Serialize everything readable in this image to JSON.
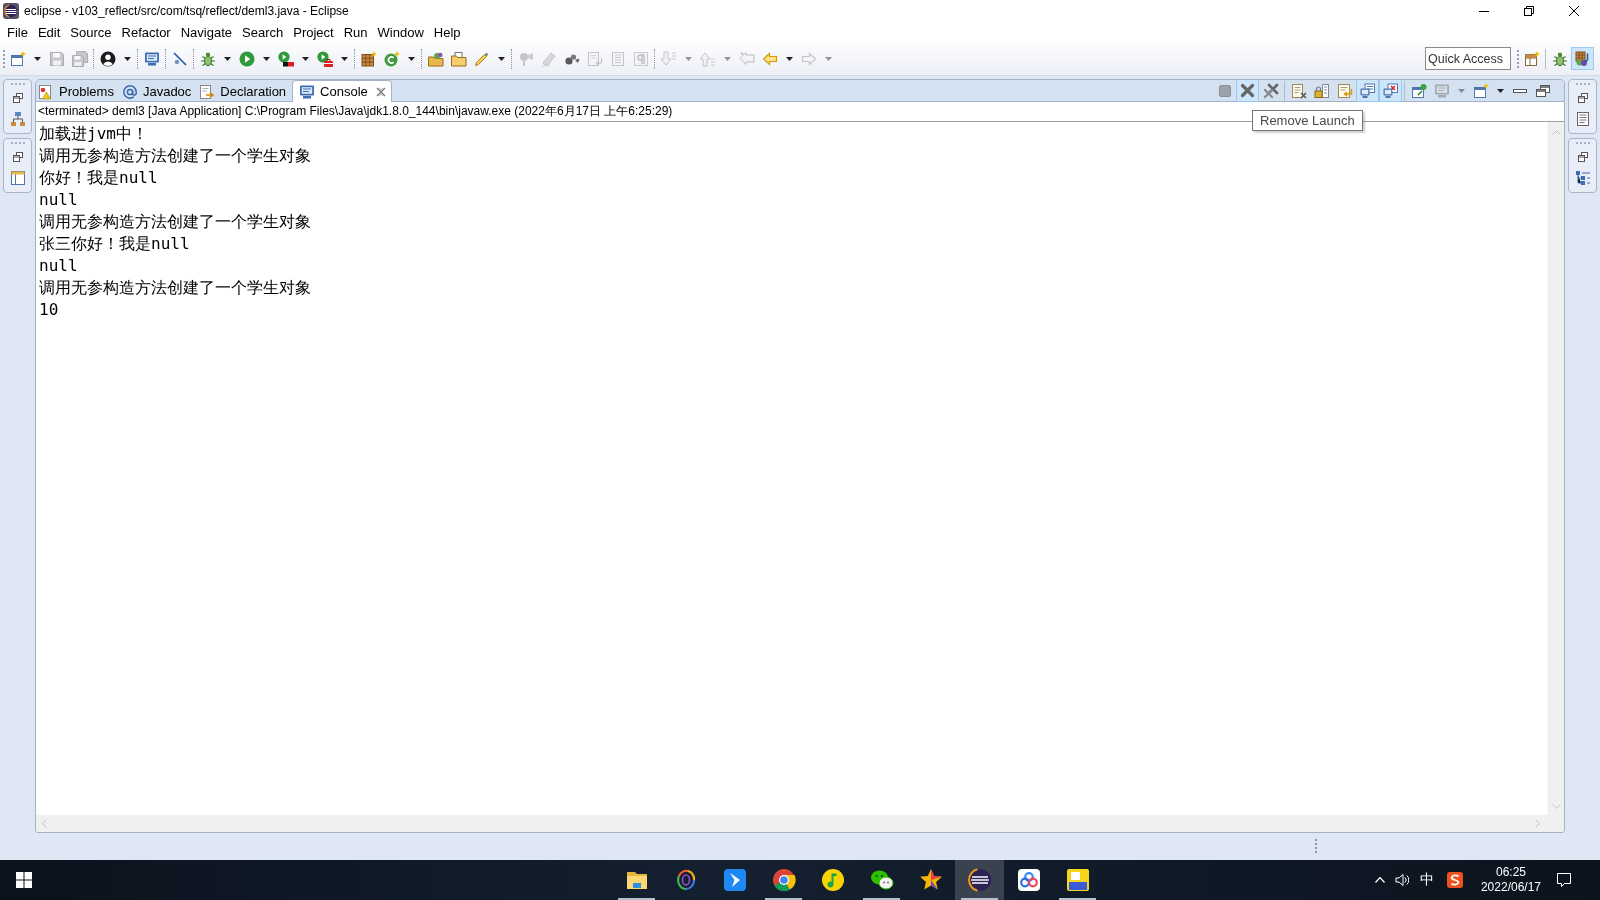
{
  "window": {
    "title": "eclipse - v103_reflect/src/com/tsq/reflect/deml3.java - Eclipse"
  },
  "menu": [
    "File",
    "Edit",
    "Source",
    "Refactor",
    "Navigate",
    "Search",
    "Project",
    "Run",
    "Window",
    "Help"
  ],
  "toolbar": {
    "items": [
      {
        "kind": "new",
        "disabled": false,
        "dropdown": true
      },
      {
        "kind": "save",
        "disabled": true,
        "dropdown": false
      },
      {
        "kind": "save_all",
        "disabled": true,
        "dropdown": false
      },
      {
        "kind": "separator"
      },
      {
        "kind": "person",
        "disabled": false,
        "dropdown": true
      },
      {
        "kind": "separator"
      },
      {
        "kind": "monitor",
        "disabled": false,
        "dropdown": false
      },
      {
        "kind": "separator"
      },
      {
        "kind": "skip",
        "disabled": false,
        "dropdown": false
      },
      {
        "kind": "separator"
      },
      {
        "kind": "debug",
        "disabled": false,
        "dropdown": true
      },
      {
        "kind": "run",
        "disabled": false,
        "dropdown": true
      },
      {
        "kind": "coverage",
        "disabled": false,
        "dropdown": true
      },
      {
        "kind": "external",
        "disabled": false,
        "dropdown": true
      },
      {
        "kind": "separator"
      },
      {
        "kind": "package",
        "disabled": false,
        "dropdown": false
      },
      {
        "kind": "class",
        "disabled": false,
        "dropdown": true
      },
      {
        "kind": "separator"
      },
      {
        "kind": "open_type",
        "disabled": false,
        "dropdown": false
      },
      {
        "kind": "open_task",
        "disabled": false,
        "dropdown": false
      },
      {
        "kind": "search",
        "disabled": false,
        "dropdown": true
      },
      {
        "kind": "separator"
      },
      {
        "kind": "pin",
        "disabled": true,
        "dropdown": false
      },
      {
        "kind": "eraser",
        "disabled": true,
        "dropdown": false
      },
      {
        "kind": "occurrences",
        "disabled": false,
        "dropdown": false
      },
      {
        "kind": "doc_arrow",
        "disabled": true,
        "dropdown": false
      },
      {
        "kind": "doc_lines",
        "disabled": true,
        "dropdown": false
      },
      {
        "kind": "pilcrow",
        "disabled": true,
        "dropdown": false
      },
      {
        "kind": "separator"
      },
      {
        "kind": "next",
        "disabled": true,
        "dropdown": true
      },
      {
        "kind": "prev",
        "disabled": true,
        "dropdown": true
      },
      {
        "kind": "last_edit",
        "disabled": true,
        "dropdown": false
      },
      {
        "kind": "back",
        "disabled": false,
        "dropdown": true
      },
      {
        "kind": "forward",
        "disabled": true,
        "dropdown": true
      }
    ],
    "quick_access": {
      "placeholder": "Quick Access"
    },
    "perspectives": [
      {
        "kind": "debug",
        "selected": false
      },
      {
        "kind": "java",
        "selected": true
      }
    ]
  },
  "view": {
    "tabs": [
      {
        "label": "Problems",
        "kind": "problems",
        "selected": false
      },
      {
        "label": "Javadoc",
        "kind": "javadoc",
        "selected": false
      },
      {
        "label": "Declaration",
        "kind": "declaration",
        "selected": false
      },
      {
        "label": "Console",
        "kind": "console",
        "selected": true
      }
    ],
    "toolbar": [
      {
        "kind": "terminate",
        "disabled": true,
        "highlighted": false,
        "dropdown": false
      },
      {
        "kind": "remove",
        "disabled": false,
        "highlighted": true,
        "dropdown": false
      },
      {
        "kind": "remove_all",
        "disabled": false,
        "highlighted": false,
        "dropdown": false
      },
      {
        "kind": "separator"
      },
      {
        "kind": "clear",
        "disabled": false,
        "highlighted": false,
        "dropdown": false
      },
      {
        "kind": "scroll_lock",
        "disabled": false,
        "highlighted": false,
        "dropdown": false
      },
      {
        "kind": "word_wrap",
        "disabled": false,
        "highlighted": false,
        "dropdown": false
      },
      {
        "kind": "stdout",
        "disabled": false,
        "highlighted": true,
        "dropdown": false
      },
      {
        "kind": "stderr",
        "disabled": false,
        "highlighted": true,
        "dropdown": false
      },
      {
        "kind": "separator"
      },
      {
        "kind": "pin",
        "disabled": false,
        "highlighted": false,
        "dropdown": false
      },
      {
        "kind": "display",
        "disabled": true,
        "highlighted": false,
        "dropdown": true
      },
      {
        "kind": "open_console",
        "disabled": false,
        "highlighted": false,
        "dropdown": true
      },
      {
        "kind": "minimize",
        "disabled": false,
        "highlighted": false,
        "dropdown": false
      },
      {
        "kind": "maximize",
        "disabled": false,
        "highlighted": false,
        "dropdown": false
      }
    ],
    "tooltip": "Remove Launch",
    "console": {
      "header": "<terminated> deml3 [Java Application] C:\\Program Files\\Java\\jdk1.8.0_144\\bin\\javaw.exe (2022年6月17日 上午6:25:29)",
      "lines": [
        "加载进jvm中！",
        "调用无参构造方法创建了一个学生对象",
        "你好！我是null",
        "null",
        "调用无参构造方法创建了一个学生对象",
        "张三你好！我是null",
        "null",
        "调用无参构造方法创建了一个学生对象",
        "10"
      ]
    }
  },
  "taskbar": {
    "apps": [
      {
        "kind": "folder",
        "running": true,
        "selected": false
      },
      {
        "kind": "rings",
        "running": false,
        "selected": false
      },
      {
        "kind": "bird",
        "running": false,
        "selected": false
      },
      {
        "kind": "browser",
        "running": true,
        "selected": false
      },
      {
        "kind": "music",
        "running": false,
        "selected": false
      },
      {
        "kind": "chat",
        "running": true,
        "selected": false
      },
      {
        "kind": "star",
        "running": false,
        "selected": false
      },
      {
        "kind": "ide",
        "running": true,
        "selected": true
      },
      {
        "kind": "cloud",
        "running": false,
        "selected": false
      },
      {
        "kind": "tile",
        "running": true,
        "selected": false
      }
    ],
    "tray": {
      "input_method": "中",
      "time": "06:25",
      "date": "2022/06/17"
    }
  }
}
